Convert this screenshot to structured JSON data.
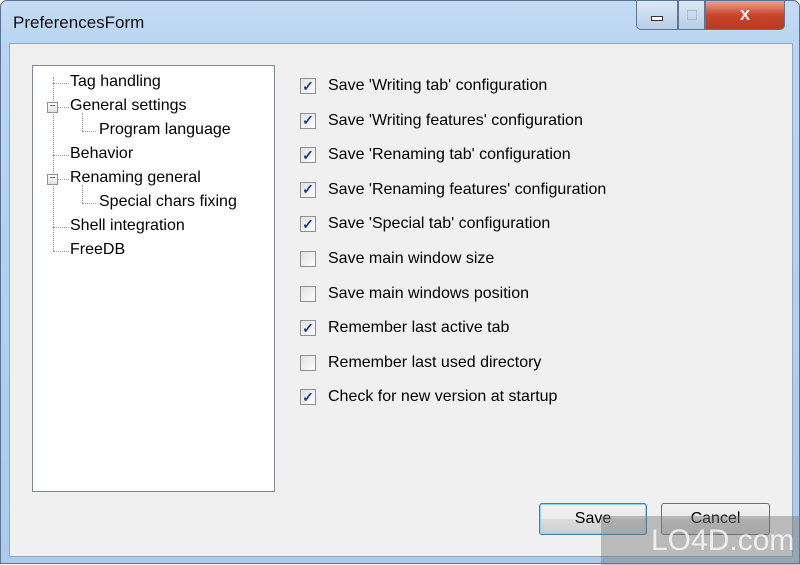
{
  "window": {
    "title": "PreferencesForm",
    "close_glyph": "X"
  },
  "tree": [
    {
      "label": "Tag handling",
      "level": 0
    },
    {
      "label": "General settings",
      "level": 0,
      "expanded": true
    },
    {
      "label": "Program language",
      "level": 1
    },
    {
      "label": "Behavior",
      "level": 0
    },
    {
      "label": "Renaming general",
      "level": 0,
      "expanded": true
    },
    {
      "label": "Special chars fixing",
      "level": 1
    },
    {
      "label": "Shell integration",
      "level": 0
    },
    {
      "label": "FreeDB",
      "level": 0
    }
  ],
  "options": [
    {
      "label": "Save 'Writing tab' configuration",
      "checked": true
    },
    {
      "label": "Save 'Writing features' configuration",
      "checked": true
    },
    {
      "label": "Save 'Renaming tab' configuration",
      "checked": true
    },
    {
      "label": "Save 'Renaming features' configuration",
      "checked": true
    },
    {
      "label": "Save 'Special tab' configuration",
      "checked": true
    },
    {
      "label": "Save main window size",
      "checked": false
    },
    {
      "label": "Save main windows position",
      "checked": false
    },
    {
      "label": "Remember last active tab",
      "checked": true
    },
    {
      "label": "Remember last used directory",
      "checked": false
    },
    {
      "label": "Check for new version at startup",
      "checked": true
    }
  ],
  "buttons": {
    "save": "Save",
    "cancel": "Cancel"
  },
  "watermark": "LO4D.com"
}
